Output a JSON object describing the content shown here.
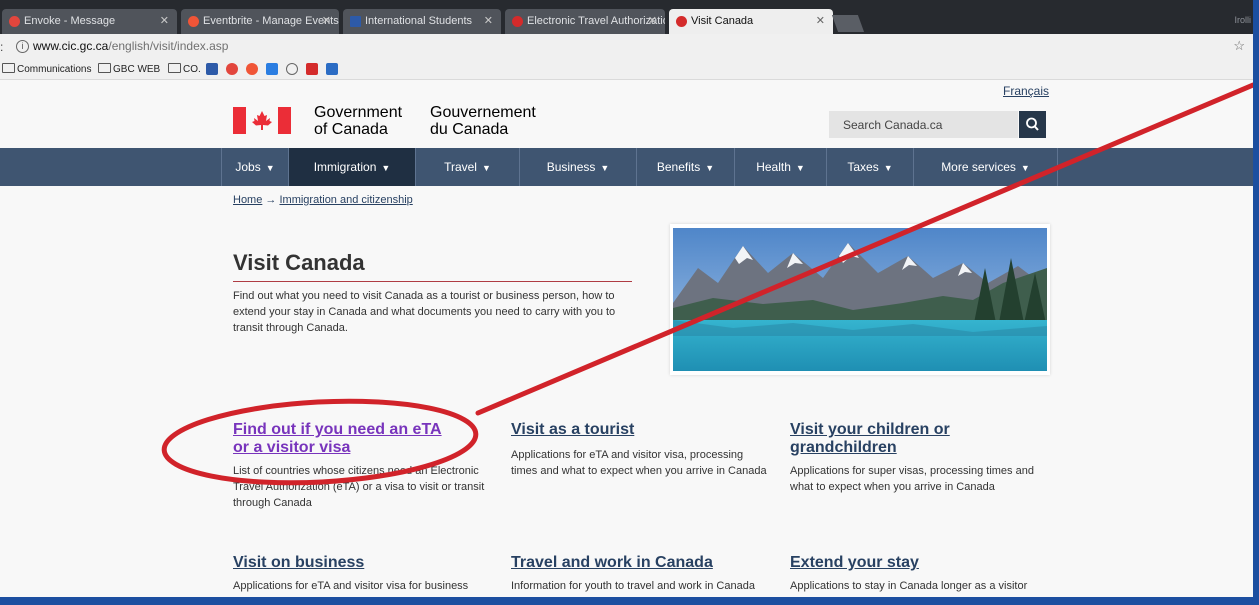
{
  "browser": {
    "tabs": [
      {
        "label": "Envoke - Message",
        "icon": "envoke-icon"
      },
      {
        "label": "Eventbrite - Manage Events",
        "icon": "eventbrite-icon"
      },
      {
        "label": "International Students",
        "icon": "gbc-icon"
      },
      {
        "label": "Electronic Travel Authorization",
        "icon": "maple-leaf-icon"
      },
      {
        "label": "Visit Canada",
        "icon": "maple-leaf-icon"
      }
    ],
    "window_label": "Irolli",
    "url_host": "www.cic.gc.ca",
    "url_path": "/english/visit/index.asp",
    "bookmarks": [
      {
        "label": "Communications"
      },
      {
        "label": "GBC WEB"
      },
      {
        "label": "CO."
      }
    ]
  },
  "header": {
    "language_link": "Français",
    "gov_en_line1": "Government",
    "gov_en_line2": "of Canada",
    "gov_fr_line1": "Gouvernement",
    "gov_fr_line2": "du Canada",
    "search_placeholder": "Search Canada.ca"
  },
  "nav": {
    "items": [
      {
        "label": "Jobs"
      },
      {
        "label": "Immigration"
      },
      {
        "label": "Travel"
      },
      {
        "label": "Business"
      },
      {
        "label": "Benefits"
      },
      {
        "label": "Health"
      },
      {
        "label": "Taxes"
      },
      {
        "label": "More services"
      }
    ],
    "active": "Immigration"
  },
  "breadcrumb": {
    "home": "Home",
    "arrow": "→",
    "section": "Immigration and citizenship"
  },
  "main": {
    "title": "Visit Canada",
    "intro": "Find out what you need to visit Canada as a tourist or business person, how to extend your stay in Canada and what documents you need to carry with you to transit through Canada.",
    "cards": [
      {
        "title_line1": "Find out if you need an eTA",
        "title_line2": "or a visitor visa",
        "desc": "List of countries whose citizens need an Electronic Travel Authorization (eTA) or a visa to visit or transit through Canada"
      },
      {
        "title_line1": "Visit as a tourist",
        "title_line2": "",
        "desc": "Applications for eTA and visitor visa, processing times and what to expect when you arrive in Canada"
      },
      {
        "title_line1": "Visit your children or",
        "title_line2": "grandchildren",
        "desc": "Applications for super visas, processing times and what to expect when you arrive in Canada"
      },
      {
        "title_line1": "Visit on business",
        "title_line2": "",
        "desc": "Applications for eTA and visitor visa for business"
      },
      {
        "title_line1": "Travel and work in Canada",
        "title_line2": "",
        "desc": "Information for youth to travel and work in Canada"
      },
      {
        "title_line1": "Extend your stay",
        "title_line2": "",
        "desc": "Applications to stay in Canada longer as a visitor"
      }
    ]
  },
  "colors": {
    "page_border": "#1c4fa0",
    "nav_bg": "#3f5571",
    "nav_active": "#1f2f42",
    "link": "#284162",
    "visited_link": "#7834bc",
    "flag_red": "#eb2d37",
    "title_rule": "#af3c43",
    "annotation_red": "#d1232a"
  }
}
